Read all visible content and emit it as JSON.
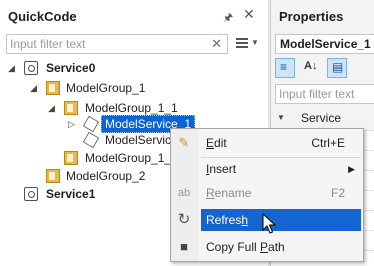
{
  "quickcode": {
    "title": "QuickCode",
    "pin_icon": "pin-icon",
    "close_icon": "close-icon",
    "filter_placeholder": "Input filter text",
    "tree": {
      "service0": "Service0",
      "model_group_1": "ModelGroup_1",
      "model_group_1_1": "ModelGroup_1_1",
      "model_service_1": "ModelService_1",
      "model_service_2_partial": "ModelServic",
      "model_group_1_2": "ModelGroup_1_2",
      "model_group_2": "ModelGroup_2",
      "service1": "Service1"
    }
  },
  "properties": {
    "title": "Properties",
    "object_name": "ModelService_1",
    "filter_placeholder": "Input filter text",
    "category": "Service"
  },
  "context_menu": {
    "items": [
      {
        "label_mnemonic": "E",
        "label_rest": "dit",
        "shortcut": "Ctrl+E",
        "icon": "pencil-icon"
      },
      {
        "label_mnemonic": "I",
        "label_rest": "nsert",
        "icon": ""
      },
      {
        "label_mnemonic": "R",
        "label_rest": "ename",
        "shortcut": "F2",
        "icon": "rename-icon",
        "disabled": true
      },
      {
        "label_prefix": "Refres",
        "label_mnemonic": "h",
        "icon": "refresh-icon",
        "highlighted": true
      },
      {
        "label_prefix": "Copy Full ",
        "label_mnemonic": "P",
        "label_rest": "ath",
        "icon": "copy-path-icon"
      }
    ]
  },
  "colors": {
    "selection": "#0a64d8",
    "menu_highlight": "#1464d2",
    "group_folder": "#e8b84a"
  }
}
